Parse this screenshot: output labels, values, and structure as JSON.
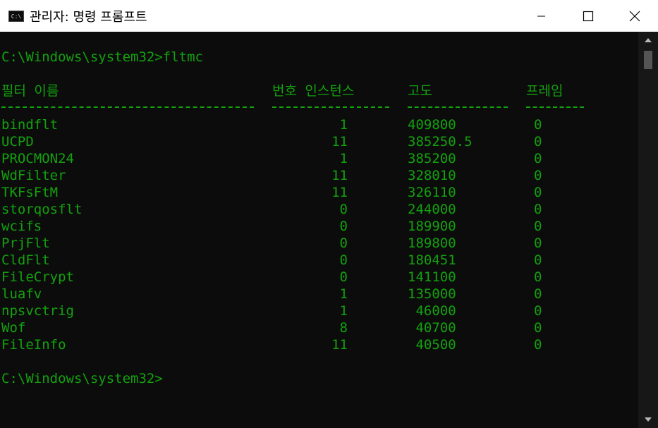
{
  "window": {
    "title": "관리자: 명령 프롬프트",
    "app_icon_text": "C:\\"
  },
  "terminal": {
    "command_line": "C:\\Windows\\system32>fltmc",
    "headers": {
      "name": "필터 이름",
      "instances": "번호 인스턴스",
      "altitude": "고도",
      "frame": "프레임"
    },
    "rows": [
      {
        "name": "bindflt",
        "instances": "1",
        "altitude": "409800",
        "frame": "0"
      },
      {
        "name": "UCPD",
        "instances": "11",
        "altitude": "385250.5",
        "frame": "0"
      },
      {
        "name": "PROCMON24",
        "instances": "1",
        "altitude": "385200",
        "frame": "0"
      },
      {
        "name": "WdFilter",
        "instances": "11",
        "altitude": "328010",
        "frame": "0"
      },
      {
        "name": "TKFsFtM",
        "instances": "11",
        "altitude": "326110",
        "frame": "0"
      },
      {
        "name": "storqosflt",
        "instances": "0",
        "altitude": "244000",
        "frame": "0"
      },
      {
        "name": "wcifs",
        "instances": "0",
        "altitude": "189900",
        "frame": "0"
      },
      {
        "name": "PrjFlt",
        "instances": "0",
        "altitude": "189800",
        "frame": "0"
      },
      {
        "name": "CldFlt",
        "instances": "0",
        "altitude": "180451",
        "frame": "0"
      },
      {
        "name": "FileCrypt",
        "instances": "0",
        "altitude": "141100",
        "frame": "0"
      },
      {
        "name": "luafv",
        "instances": "1",
        "altitude": "135000",
        "frame": "0"
      },
      {
        "name": "npsvctrig",
        "instances": "1",
        "altitude": " 46000",
        "frame": "0"
      },
      {
        "name": "Wof",
        "instances": "8",
        "altitude": " 40700",
        "frame": "0"
      },
      {
        "name": "FileInfo",
        "instances": "11",
        "altitude": " 40500",
        "frame": "0"
      }
    ],
    "prompt": "C:\\Windows\\system32>"
  },
  "colors": {
    "terminal_fg": "#13a10e",
    "terminal_bg": "#0c0c0c",
    "titlebar_bg": "#ffffff"
  },
  "icons": [
    "console-app-icon",
    "minimize-icon",
    "maximize-icon",
    "close-icon",
    "scroll-up-arrow-icon",
    "scroll-down-arrow-icon"
  ]
}
